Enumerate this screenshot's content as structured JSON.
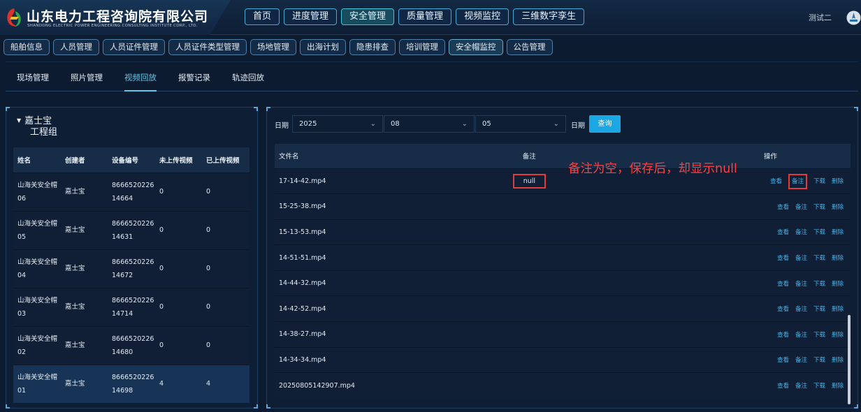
{
  "header": {
    "company_cn": "山东电力工程咨询院有限公司",
    "company_en": "SHANDONG ELECTRIC POWER ENGINEERING CONSULTING INSTITUTE CORP., LTD.",
    "nav": [
      "首页",
      "进度管理",
      "安全管理",
      "质量管理",
      "视频监控",
      "三维数字孪生"
    ],
    "active_nav": "安全管理",
    "user": "测试二"
  },
  "sub_nav": {
    "items": [
      "船舶信息",
      "人员管理",
      "人员证件管理",
      "人员证件类型管理",
      "场地管理",
      "出海计划",
      "隐患排查",
      "培训管理",
      "安全帽监控",
      "公告管理"
    ],
    "active": "安全帽监控"
  },
  "tabs": {
    "items": [
      "现场管理",
      "照片管理",
      "视频回放",
      "报警记录",
      "轨迹回放"
    ],
    "active": "视频回放"
  },
  "tree": {
    "node_line1": "嘉士宝",
    "node_line2": "工程组"
  },
  "device_table": {
    "headers": [
      "姓名",
      "创建者",
      "设备编号",
      "未上传视频",
      "已上传视频"
    ],
    "rows": [
      {
        "name1": "山海关安全帽",
        "name2": "06",
        "creator": "嘉士宝",
        "dev1": "8666520226",
        "dev2": "14664",
        "pending": "0",
        "uploaded": "0"
      },
      {
        "name1": "山海关安全帽",
        "name2": "05",
        "creator": "嘉士宝",
        "dev1": "8666520226",
        "dev2": "14631",
        "pending": "0",
        "uploaded": "0"
      },
      {
        "name1": "山海关安全帽",
        "name2": "04",
        "creator": "嘉士宝",
        "dev1": "8666520226",
        "dev2": "14672",
        "pending": "0",
        "uploaded": "0"
      },
      {
        "name1": "山海关安全帽",
        "name2": "03",
        "creator": "嘉士宝",
        "dev1": "8666520226",
        "dev2": "14714",
        "pending": "0",
        "uploaded": "0"
      },
      {
        "name1": "山海关安全帽",
        "name2": "02",
        "creator": "嘉士宝",
        "dev1": "8666520226",
        "dev2": "14680",
        "pending": "0",
        "uploaded": "0"
      },
      {
        "name1": "山海关安全帽",
        "name2": "01",
        "creator": "嘉士宝",
        "dev1": "8666520226",
        "dev2": "14698",
        "pending": "4",
        "uploaded": "4"
      }
    ]
  },
  "filter": {
    "label1": "日期",
    "year": "2025",
    "month": "08",
    "day": "05",
    "label2": "日期",
    "query": "查询"
  },
  "file_table": {
    "headers": [
      "文件名",
      "备注",
      "操作"
    ],
    "ops": [
      "查看",
      "备注",
      "下载",
      "删除"
    ],
    "rows": [
      {
        "file": "17-14-42.mp4",
        "note": "null"
      },
      {
        "file": "15-25-38.mp4",
        "note": ""
      },
      {
        "file": "15-13-53.mp4",
        "note": ""
      },
      {
        "file": "14-51-51.mp4",
        "note": ""
      },
      {
        "file": "14-44-32.mp4",
        "note": ""
      },
      {
        "file": "14-42-52.mp4",
        "note": ""
      },
      {
        "file": "14-38-27.mp4",
        "note": ""
      },
      {
        "file": "14-34-34.mp4",
        "note": ""
      },
      {
        "file": "20250805142907.mp4",
        "note": ""
      }
    ]
  },
  "annotation": "备注为空，保存后，却显示null"
}
